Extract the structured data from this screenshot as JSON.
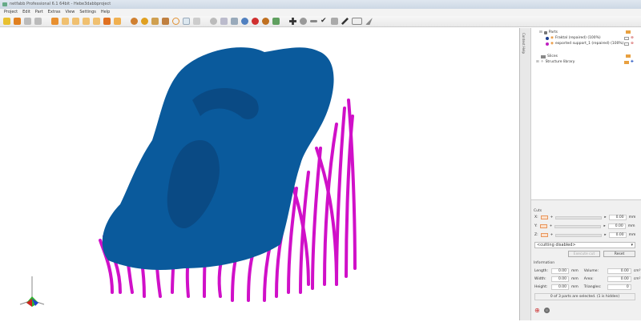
{
  "window": {
    "title": "netfabb Professional 6.1 64bit - Hebe3dabbproject"
  },
  "menu": [
    "Project",
    "Edit",
    "Part",
    "Extras",
    "View",
    "Settings",
    "Help"
  ],
  "side_tab": {
    "label": "Context Help"
  },
  "tree": {
    "parts_label": "Parts",
    "parts": [
      {
        "name": "Fraktal (repaired) (100%)",
        "color": "#1a3d8f"
      },
      {
        "name": "exported support_1 (repaired) (100%)",
        "color": "#c020c0"
      }
    ],
    "slices_label": "Slices",
    "library_label": "Structure library"
  },
  "cuts": {
    "heading": "Cuts",
    "axes": [
      {
        "axis": "X:",
        "value": "0.00",
        "unit": "mm"
      },
      {
        "axis": "Y:",
        "value": "0.00",
        "unit": "mm"
      },
      {
        "axis": "Z:",
        "value": "0.00",
        "unit": "mm"
      }
    ],
    "mode": "<cutting disabled>",
    "execute": "Execute cut",
    "reset": "Reset"
  },
  "info": {
    "heading": "Information",
    "length_label": "Length:",
    "length": "0.00",
    "width_label": "Width:",
    "width": "0.00",
    "height_label": "Height:",
    "height": "0.00",
    "unit": "mm",
    "volume_label": "Volume:",
    "volume": "0.00",
    "volume_unit": "cm³",
    "area_label": "Area:",
    "area": "0.00",
    "area_unit": "cm²",
    "triangles_label": "Triangles:",
    "triangles": "0"
  },
  "status": "0 of 3 parts are selected. (1 is hidden)",
  "colors": {
    "model": "#0a5a9c",
    "supports": "#d010c8"
  }
}
